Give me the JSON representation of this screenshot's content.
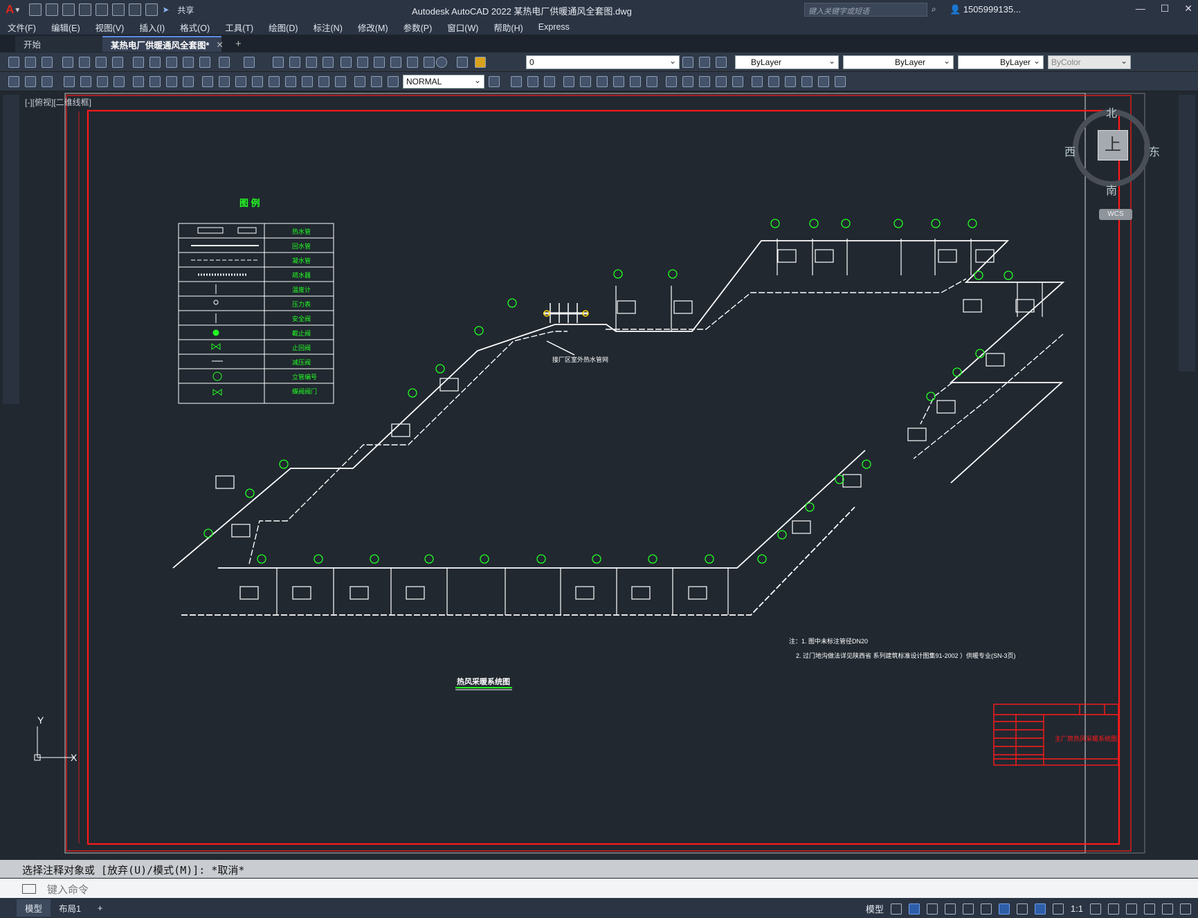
{
  "app": {
    "logo": "A",
    "title": "Autodesk AutoCAD 2022    某热电厂供暖通风全套图.dwg",
    "share_label": "共享",
    "search_placeholder": "键入关键字或短语",
    "user_label": "1505999135...",
    "win_controls": [
      "—",
      "☐",
      "✕"
    ]
  },
  "menu": [
    "文件(F)",
    "编辑(E)",
    "视图(V)",
    "插入(I)",
    "格式(O)",
    "工具(T)",
    "绘图(D)",
    "标注(N)",
    "修改(M)",
    "参数(P)",
    "窗口(W)",
    "帮助(H)",
    "Express"
  ],
  "tabs": {
    "start": "开始",
    "active": "某热电厂供暖通风全套图*",
    "close": "✕",
    "add": "+"
  },
  "toolbar": {
    "layer_value": "0",
    "color_value": "ByLayer",
    "linetype_value": "ByLayer",
    "lineweight_value": "ByLayer",
    "plotstyle_value": "ByColor",
    "dimstyle_value": "NORMAL"
  },
  "view_label": "[-][俯视][二维线框]",
  "viewcube": {
    "north": "北",
    "south": "南",
    "west": "西",
    "east": "东",
    "face": "上",
    "wcs": "WCS"
  },
  "drawing": {
    "legend_title": "图 例",
    "legend_rows": [
      "热水管",
      "回水管",
      "凝水管",
      "疏水器",
      "温度计",
      "压力表",
      "安全阀",
      "截止阀",
      "止回阀",
      "减压阀",
      "立管编号",
      "蝶阀阀门"
    ],
    "callout": "接厂区室外热水管网",
    "notes_1": "注：1. 图中未标注管径DN20",
    "notes_2": "2. 过门地沟做法详见陕西省 系列建筑标准设计图集91-2002 ）供暖专业(SN-3页)",
    "system_title": "热风采暖系统图",
    "titleblock_name": "主厂房热风采暖系统图",
    "ucs_y": "Y",
    "ucs_x": "X"
  },
  "command": {
    "history": "选择注释对象或 [放弃(U)/模式(M)]: *取消*",
    "prompt_placeholder": "键入命令"
  },
  "status": {
    "layout_tabs": [
      "模型",
      "布局1",
      "+"
    ],
    "model_label": "模型",
    "scale": "1:1"
  },
  "colors": {
    "background": "#212830",
    "border": "#ff1a1a",
    "pipe": "#ffffff",
    "symbol": "#22ff22"
  }
}
